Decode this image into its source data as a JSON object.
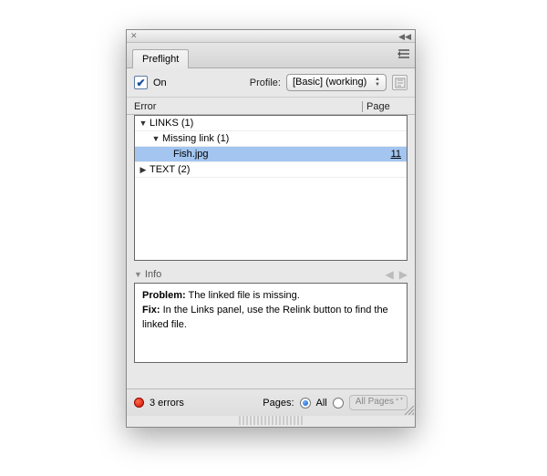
{
  "tab": {
    "title": "Preflight"
  },
  "controls": {
    "on_label": "On",
    "on_checked": true,
    "profile_label": "Profile:",
    "profile_value": "[Basic] (working)"
  },
  "columns": {
    "error": "Error",
    "page": "Page"
  },
  "tree": {
    "items": [
      {
        "label": "LINKS (1)",
        "expanded": true,
        "depth": 0
      },
      {
        "label": "Missing link (1)",
        "expanded": true,
        "depth": 1
      },
      {
        "label": "Fish.jpg",
        "page": "11",
        "selected": true,
        "depth": 2
      },
      {
        "label": "TEXT (2)",
        "expanded": false,
        "depth": 0
      }
    ]
  },
  "info": {
    "header": "Info",
    "problem_label": "Problem:",
    "problem_text": "The linked file is missing.",
    "fix_label": "Fix:",
    "fix_text": "In the Links panel, use the Relink button to find the linked file."
  },
  "footer": {
    "status_text": "3 errors",
    "pages_label": "Pages:",
    "all_label": "All",
    "range_label": "All Pages"
  }
}
